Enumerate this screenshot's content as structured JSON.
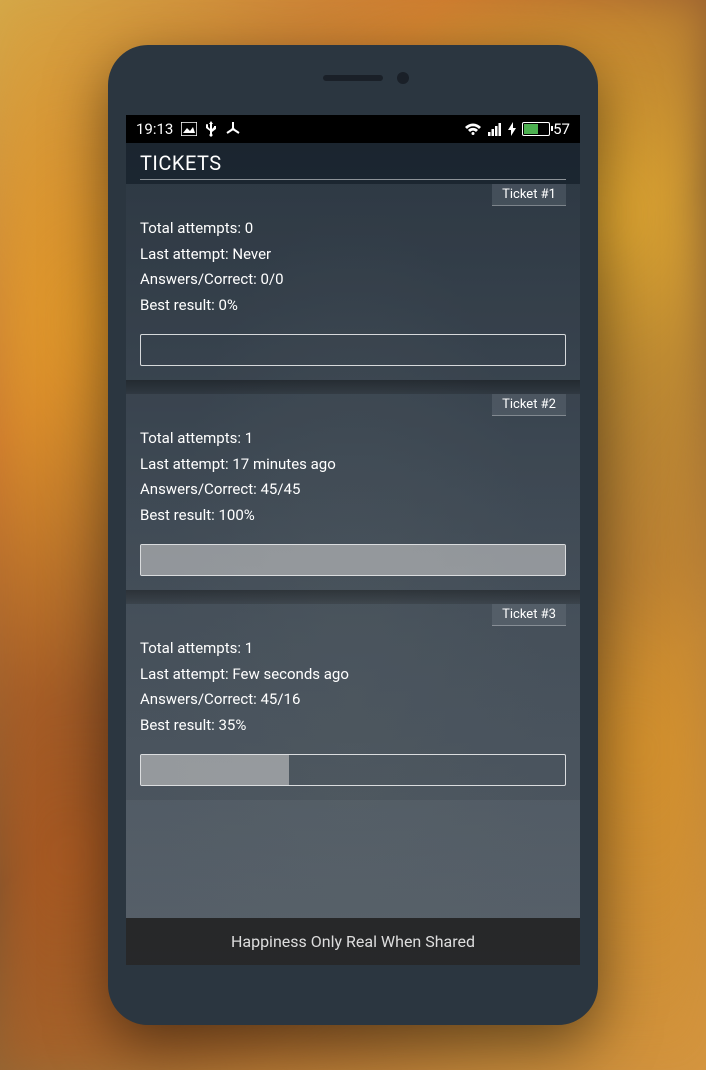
{
  "status_bar": {
    "time": "19:13",
    "battery_level": "57"
  },
  "header": {
    "title": "TICKETS"
  },
  "tickets": [
    {
      "label": "Ticket #1",
      "total_attempts": "Total attempts: 0",
      "last_attempt": "Last attempt: Never",
      "answers_correct": "Answers/Correct: 0/0",
      "best_result": "Best result: 0%",
      "progress_percent": 0
    },
    {
      "label": "Ticket #2",
      "total_attempts": "Total attempts: 1",
      "last_attempt": "Last attempt: 17 minutes ago",
      "answers_correct": "Answers/Correct: 45/45",
      "best_result": "Best result: 100%",
      "progress_percent": 100
    },
    {
      "label": "Ticket #3",
      "total_attempts": "Total attempts: 1",
      "last_attempt": "Last attempt: Few seconds ago",
      "answers_correct": "Answers/Correct: 45/16",
      "best_result": "Best result: 35%",
      "progress_percent": 35
    }
  ],
  "banner": {
    "text": "Happiness Only Real When Shared"
  }
}
